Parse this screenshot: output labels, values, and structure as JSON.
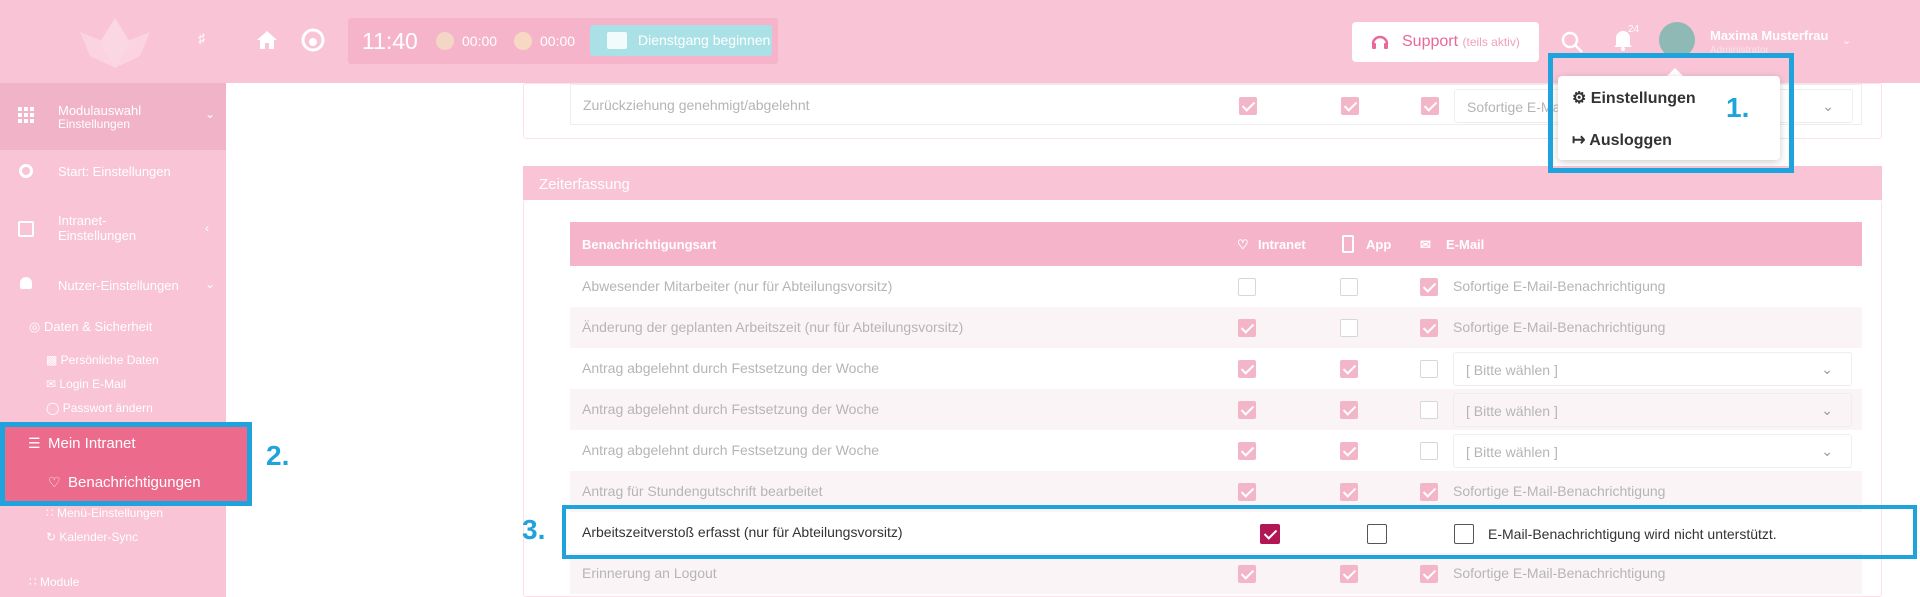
{
  "header": {
    "clock": "11:40",
    "timer_1": "00:00",
    "timer_2": "00:00",
    "duty_button": "Dienstgang beginnen",
    "support_label": "Support",
    "support_note": "(teils aktiv)",
    "notifications_count": "24",
    "user_name": "Maxima Musterfrau",
    "user_role": "Administrator"
  },
  "user_menu": {
    "settings": "Einstellungen",
    "logout": "Ausloggen"
  },
  "sidebar": {
    "module_select_title": "Modulauswahl",
    "module_select_sub": "Einstellungen",
    "start": "Start: Einstellungen",
    "intranet_1": "Intranet-",
    "intranet_2": "Einstellungen",
    "user_settings": "Nutzer-Einstellungen",
    "data_security": "Daten & Sicherheit",
    "personal_data": "Persönliche Daten",
    "login_email": "Login E-Mail",
    "change_password": "Passwort ändern",
    "my_intranet": "Mein Intranet",
    "notifications": "Benachrichtigungen",
    "menu_settings": "Menü-Einstellungen",
    "calendar_sync": "Kalender-Sync",
    "modules": "Module"
  },
  "annotations": {
    "step1": "1.",
    "step2": "2.",
    "step3": "3."
  },
  "top_row": {
    "label": "Zurückziehung genehmigt/abgelehnt",
    "email_option": "Sofortige E-Mail-Benachrichtigung"
  },
  "section": {
    "title": "Zeiterfassung",
    "col_type": "Benachrichtigungsart",
    "col_intranet": "Intranet",
    "col_app": "App",
    "col_email": "E-Mail"
  },
  "rows": [
    {
      "label": "Abwesender Mitarbeiter (nur für Abteilungsvorsitz)",
      "intranet": false,
      "app": false,
      "email": true,
      "option": "Sofortige E-Mail-Benachrichtigung"
    },
    {
      "label": "Änderung der geplanten Arbeitszeit (nur für Abteilungsvorsitz)",
      "intranet": true,
      "app": false,
      "email": true,
      "option": "Sofortige E-Mail-Benachrichtigung"
    },
    {
      "label": "Antrag abgelehnt durch Festsetzung der Woche",
      "intranet": true,
      "app": true,
      "email": false,
      "option": "[ Bitte wählen ]"
    },
    {
      "label": "Antrag abgelehnt durch Festsetzung der Woche",
      "intranet": true,
      "app": true,
      "email": false,
      "option": "[ Bitte wählen ]"
    },
    {
      "label": "Antrag abgelehnt durch Festsetzung der Woche",
      "intranet": true,
      "app": true,
      "email": false,
      "option": "[ Bitte wählen ]"
    },
    {
      "label": "Antrag für Stundengutschrift bearbeitet",
      "intranet": true,
      "app": true,
      "email": true,
      "option": "Sofortige E-Mail-Benachrichtigung"
    },
    {
      "label": "Arbeitszeitverstoß erfasst (nur für Abteilungsvorsitz)",
      "intranet": true,
      "app": false,
      "email": false,
      "option": "E-Mail-Benachrichtigung wird nicht unterstützt."
    },
    {
      "label": "Erinnerung an Logout",
      "intranet": true,
      "app": true,
      "email": true,
      "option": "Sofortige E-Mail-Benachrichtigung"
    }
  ]
}
